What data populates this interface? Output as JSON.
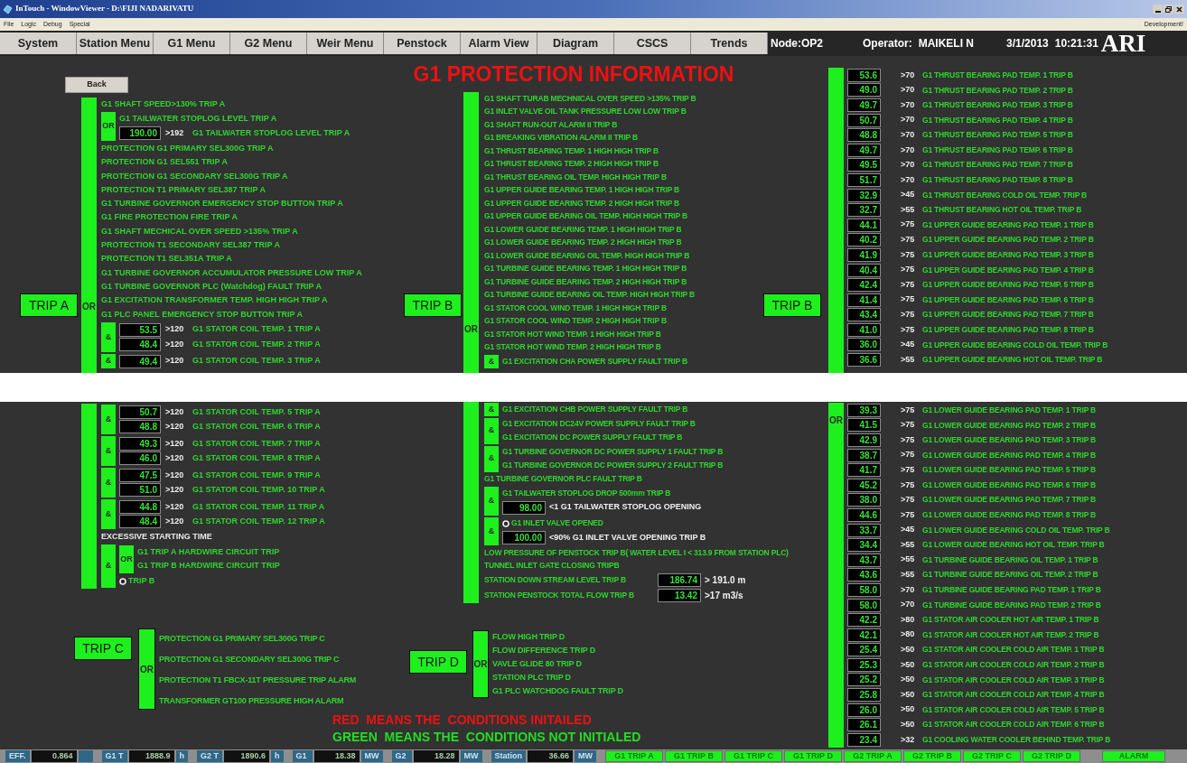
{
  "window": {
    "title": "InTouch - WindowViewer - D:\\FIJI NADARIVATU"
  },
  "menu": [
    "File",
    "Logic",
    "Debug",
    "Special"
  ],
  "mode": "Development!",
  "nav": [
    "System",
    "Station Menu",
    "G1 Menu",
    "G2 Menu",
    "Weir Menu",
    "Penstock",
    "Alarm View",
    "Diagram",
    "CSCS",
    "Trends"
  ],
  "node": "Node:OP2",
  "operator_label": "Operator:",
  "operator": "MAIKELI N",
  "date": "3/1/2013",
  "time": "10:21:31",
  "logo": "ARI",
  "page_title": "G1 PROTECTION INFORMATION",
  "back": "Back",
  "top": {
    "left": {
      "trip": "TRIP A",
      "gate_label": "OR",
      "rows": [
        {
          "kind": "text",
          "text": "G1 SHAFT SPEED>130% TRIP A"
        },
        {
          "kind": "gate",
          "label": "OR",
          "rows": [
            {
              "kind": "text",
              "text": "G1 TAILWATER STOPLOG LEVEL TRIP A"
            },
            {
              "kind": "reading",
              "value": "190.00",
              "limit": ">192",
              "text": "G1 TAILWATER STOPLOG LEVEL TRIP A"
            }
          ]
        },
        {
          "kind": "text",
          "text": "PROTECTION G1 PRIMARY SEL300G TRIP A"
        },
        {
          "kind": "text",
          "text": "PROTECTION G1 SEL551 TRIP A"
        },
        {
          "kind": "text",
          "text": "PROTECTION G1 SECONDARY SEL300G TRIP A"
        },
        {
          "kind": "text",
          "text": "PROTECTION T1 PRIMARY SEL387 TRIP A"
        },
        {
          "kind": "text",
          "text": "G1 TURBINE GOVERNOR EMERGENCY STOP BUTTON TRIP A"
        },
        {
          "kind": "text",
          "text": "G1 FIRE PROTECTION FIRE TRIP A"
        },
        {
          "kind": "text",
          "text": "G1 SHAFT MECHICAL OVER SPEED >135% TRIP A"
        },
        {
          "kind": "text",
          "text": "PROTECTION T1 SECONDARY SEL387 TRIP A"
        },
        {
          "kind": "text",
          "text": "PROTECTION T1 SEL351A TRIP A"
        },
        {
          "kind": "text",
          "text": "G1 TURBINE GOVERNOR ACCUMULATOR PRESSURE LOW TRIP A"
        },
        {
          "kind": "text",
          "text": "G1 TURBINE GOVERNOR PLC (Watchdog) FAULT TRIP A"
        },
        {
          "kind": "text",
          "text": "G1 EXCITATION TRANSFORMER TEMP. HIGH HIGH TRIP A"
        },
        {
          "kind": "text",
          "text": "G1 PLC PANEL EMERGENCY STOP BUTTON TRIP A"
        },
        {
          "kind": "gate",
          "label": "&",
          "rows": [
            {
              "kind": "reading",
              "value": "53.5",
              "limit": ">120",
              "text": "G1 STATOR COIL TEMP. 1 TRIP A"
            },
            {
              "kind": "reading",
              "value": "48.4",
              "limit": ">120",
              "text": "G1 STATOR COIL TEMP. 2 TRIP A"
            }
          ]
        },
        {
          "kind": "gate",
          "label": "&",
          "rows": [
            {
              "kind": "reading",
              "value": "49.4",
              "limit": ">120",
              "text": "G1 STATOR COIL TEMP. 3 TRIP A"
            }
          ]
        }
      ]
    },
    "middle": {
      "trip": "TRIP B",
      "gate_label": "OR",
      "rows": [
        {
          "kind": "text",
          "text": "G1 SHAFT TURAB MECHNICAL OVER SPEED >135% TRIP B"
        },
        {
          "kind": "text",
          "text": "G1 INLET VALVE OIL TANK PRESSURE LOW LOW TRIP B"
        },
        {
          "kind": "text",
          "text": "G1 SHAFT RUN-OUT ALARM II TRIP B"
        },
        {
          "kind": "text",
          "text": "G1 BREAKING VIBRATION ALARM II TRIP B"
        },
        {
          "kind": "text",
          "text": "G1 THRUST BEARING TEMP. 1 HIGH HIGH TRIP B"
        },
        {
          "kind": "text",
          "text": "G1 THRUST BEARING TEMP. 2 HIGH HIGH TRIP B"
        },
        {
          "kind": "text",
          "text": "G1 THRUST BEARING OIL TEMP. HIGH HIGH TRIP B"
        },
        {
          "kind": "text",
          "text": "G1 UPPER GUIDE BEARING TEMP. 1 HIGH HIGH TRIP B"
        },
        {
          "kind": "text",
          "text": "G1 UPPER GUIDE BEARING TEMP. 2 HIGH HIGH TRIP B"
        },
        {
          "kind": "text",
          "text": "G1 UPPER GUIDE BEARING OIL TEMP. HIGH HIGH TRIP B"
        },
        {
          "kind": "text",
          "text": "G1 LOWER GUIDE BEARING TEMP. 1 HIGH HIGH TRIP B"
        },
        {
          "kind": "text",
          "text": "G1 LOWER GUIDE BEARING TEMP. 2 HIGH HIGH TRIP B"
        },
        {
          "kind": "text",
          "text": "G1 LOWER GUIDE BEARING OIL TEMP. HIGH HIGH TRIP B"
        },
        {
          "kind": "text",
          "text": "G1 TURBINE GUIDE BEARING TEMP. 1 HIGH HIGH TRIP B"
        },
        {
          "kind": "text",
          "text": "G1 TURBINE GUIDE BEARING TEMP. 2 HIGH HIGH TRIP B"
        },
        {
          "kind": "text",
          "text": "G1 TURBINE GUIDE BEARING OIL TEMP. HIGH HIGH TRIP B"
        },
        {
          "kind": "text",
          "text": "G1 STATOR COOL WIND TEMP. 1 HIGH HIGH TRIP B"
        },
        {
          "kind": "text",
          "text": "G1 STATOR COOL WIND TEMP. 2 HIGH HIGH TRIP B"
        },
        {
          "kind": "text",
          "text": "G1 STATOR HOT WIND TEMP. 1 HIGH HIGH TRIP B"
        },
        {
          "kind": "text",
          "text": "G1 STATOR HOT WIND TEMP. 2 HIGH HIGH TRIP B"
        },
        {
          "kind": "gate",
          "label": "&",
          "rows": [
            {
              "kind": "text",
              "text": "G1 EXCITATION CHA POWER SUPPLY FAULT TRIP B"
            }
          ]
        }
      ]
    },
    "right": {
      "trip": "TRIP B",
      "rows": [
        {
          "kind": "reading",
          "value": "53.6",
          "limit": ">70",
          "text": "G1 THRUST BEARING PAD TEMP. 1 TRIP B"
        },
        {
          "kind": "reading",
          "value": "49.0",
          "limit": ">70",
          "text": "G1 THRUST BEARING PAD TEMP. 2 TRIP B"
        },
        {
          "kind": "reading",
          "value": "49.7",
          "limit": ">70",
          "text": "G1 THRUST BEARING PAD TEMP. 3 TRIP B"
        },
        {
          "kind": "reading",
          "value": "50.7",
          "limit": ">70",
          "text": "G1 THRUST BEARING PAD TEMP. 4 TRIP B"
        },
        {
          "kind": "reading",
          "value": "48.8",
          "limit": ">70",
          "text": "G1 THRUST BEARING PAD TEMP. 5 TRIP B"
        },
        {
          "kind": "reading",
          "value": "49.7",
          "limit": ">70",
          "text": "G1 THRUST BEARING PAD TEMP. 6 TRIP B"
        },
        {
          "kind": "reading",
          "value": "49.5",
          "limit": ">70",
          "text": "G1 THRUST BEARING PAD TEMP. 7 TRIP B"
        },
        {
          "kind": "reading",
          "value": "51.7",
          "limit": ">70",
          "text": "G1 THRUST BEARING PAD TEMP. 8 TRIP B"
        },
        {
          "kind": "reading",
          "value": "32.9",
          "limit": ">45",
          "text": "G1 THRUST BEARING COLD OIL TEMP. TRIP B"
        },
        {
          "kind": "reading",
          "value": "32.7",
          "limit": ">55",
          "text": "G1 THRUST BEARING HOT OIL TEMP. TRIP B"
        },
        {
          "kind": "reading",
          "value": "44.1",
          "limit": ">75",
          "text": "G1 UPPER GUIDE BEARING PAD TEMP. 1 TRIP B"
        },
        {
          "kind": "reading",
          "value": "40.2",
          "limit": ">75",
          "text": "G1 UPPER GUIDE BEARING PAD TEMP. 2 TRIP B"
        },
        {
          "kind": "reading",
          "value": "41.9",
          "limit": ">75",
          "text": "G1 UPPER GUIDE BEARING PAD TEMP. 3 TRIP B"
        },
        {
          "kind": "reading",
          "value": "40.4",
          "limit": ">75",
          "text": "G1 UPPER GUIDE BEARING PAD TEMP. 4 TRIP B"
        },
        {
          "kind": "reading",
          "value": "42.4",
          "limit": ">75",
          "text": "G1 UPPER GUIDE BEARING PAD TEMP. 5 TRIP B"
        },
        {
          "kind": "reading",
          "value": "41.4",
          "limit": ">75",
          "text": "G1 UPPER GUIDE BEARING PAD TEMP. 6 TRIP B"
        },
        {
          "kind": "reading",
          "value": "43.4",
          "limit": ">75",
          "text": "G1 UPPER GUIDE BEARING PAD TEMP. 7 TRIP B"
        },
        {
          "kind": "reading",
          "value": "41.0",
          "limit": ">75",
          "text": "G1 UPPER GUIDE BEARING PAD TEMP. 8 TRIP B"
        },
        {
          "kind": "reading",
          "value": "36.0",
          "limit": ">45",
          "text": "G1 UPPER GUIDE BEARING COLD OIL TEMP. TRIP B"
        },
        {
          "kind": "reading",
          "value": "36.6",
          "limit": ">55",
          "text": "G1 UPPER GUIDE BEARING HOT OIL TEMP. TRIP B"
        }
      ]
    }
  },
  "bottom": {
    "left": {
      "rows": [
        {
          "kind": "gate",
          "label": "&",
          "rows": [
            {
              "kind": "reading",
              "value": "50.7",
              "limit": ">120",
              "text": "G1 STATOR COIL TEMP. 5 TRIP A"
            },
            {
              "kind": "reading",
              "value": "48.8",
              "limit": ">120",
              "text": "G1 STATOR COIL TEMP. 6 TRIP A"
            }
          ]
        },
        {
          "kind": "gate",
          "label": "&",
          "rows": [
            {
              "kind": "reading",
              "value": "49.3",
              "limit": ">120",
              "text": "G1 STATOR COIL TEMP. 7 TRIP A"
            },
            {
              "kind": "reading",
              "value": "46.0",
              "limit": ">120",
              "text": "G1 STATOR COIL TEMP. 8 TRIP A"
            }
          ]
        },
        {
          "kind": "gate",
          "label": "&",
          "rows": [
            {
              "kind": "reading",
              "value": "47.5",
              "limit": ">120",
              "text": "G1 STATOR COIL TEMP. 9 TRIP A"
            },
            {
              "kind": "reading",
              "value": "51.0",
              "limit": ">120",
              "text": "G1 STATOR COIL TEMP. 10 TRIP A"
            }
          ]
        },
        {
          "kind": "gate",
          "label": "&",
          "rows": [
            {
              "kind": "reading",
              "value": "44.8",
              "limit": ">120",
              "text": "G1 STATOR COIL TEMP. 11 TRIP A"
            },
            {
              "kind": "reading",
              "value": "48.4",
              "limit": ">120",
              "text": "G1 STATOR COIL TEMP. 12 TRIP A"
            }
          ]
        },
        {
          "kind": "note",
          "text": "EXCESSIVE STARTING TIME"
        },
        {
          "kind": "gate",
          "label": "&",
          "rows": [
            {
              "kind": "gate",
              "label": "OR",
              "rows": [
                {
                  "kind": "text",
                  "text": "G1 TRIP A HARDWIRE CIRCUIT TRIP"
                },
                {
                  "kind": "text",
                  "text": "G1 TRIP B HARDWIRE CIRCUIT TRIP"
                }
              ]
            },
            {
              "kind": "indicator",
              "text": "TRIP B"
            }
          ]
        }
      ]
    },
    "trip_c": {
      "trip": "TRIP C",
      "gate": "OR",
      "inputs": [
        "PROTECTION G1 PRIMARY SEL300G TRIP C",
        "PROTECTION G1 SECONDARY SEL300G TRIP C"
      ],
      "alarms": [
        "PROTECTION T1 FBCX-11T PRESSURE TRIP ALARM",
        "TRANSFORMER GT100 PRESSURE HIGH ALARM"
      ]
    },
    "middle": {
      "rows": [
        {
          "kind": "gate",
          "label": "&",
          "rows": [
            {
              "kind": "text",
              "text": "G1 EXCITATION CHB POWER SUPPLY FAULT TRIP B"
            }
          ]
        },
        {
          "kind": "gate",
          "label": "&",
          "rows": [
            {
              "kind": "text",
              "text": "G1 EXCITATION DC24V POWER SUPPLY FAULT TRIP B"
            },
            {
              "kind": "text",
              "text": "G1 EXCITATION DC POWER SUPPLY FAULT TRIP B"
            }
          ]
        },
        {
          "kind": "gate",
          "label": "&",
          "rows": [
            {
              "kind": "text",
              "text": "G1 TURBINE GOVERNOR DC POWER SUPPLY 1 FAULT TRIP B"
            },
            {
              "kind": "text",
              "text": "G1 TURBINE GOVERNOR DC POWER SUPPLY 2 FAULT TRIP B"
            }
          ]
        },
        {
          "kind": "text",
          "text": "G1 TURBINE GOVERNOR PLC FAULT TRIP B"
        },
        {
          "kind": "gate",
          "label": "&",
          "rows": [
            {
              "kind": "text",
              "text": "G1 TAILWATER STOPLOG DROP 500mm TRIP B"
            },
            {
              "kind": "reading",
              "value": "98.00",
              "limit": "<1 G1 TAILWATER STOPLOG OPENING"
            }
          ]
        },
        {
          "kind": "gate",
          "label": "&",
          "rows": [
            {
              "kind": "indicator",
              "text": "G1 INLET VALVE OPENED"
            },
            {
              "kind": "reading",
              "value": "100.00",
              "limit": "<90% G1 INLET VALVE OPENING TRIP B"
            }
          ]
        },
        {
          "kind": "text",
          "text": "LOW PRESSURE OF PENSTOCK TRIP B( WATER LEVEL I < 313.9 FROM STATION PLC)"
        },
        {
          "kind": "text",
          "text": "TUNNEL INLET GATE CLOSING TRIPB"
        },
        {
          "kind": "level",
          "text": "STATION DOWN STREAM LEVEL TRIP B",
          "value": "186.74",
          "limit": "> 191.0 m"
        },
        {
          "kind": "level",
          "text": "STATION PENSTOCK TOTAL FLOW TRIP B",
          "value": "13.42",
          "limit": ">17 m3/s"
        }
      ]
    },
    "trip_d": {
      "trip": "TRIP D",
      "gate": "OR",
      "inputs": [
        "FLOW HIGH TRIP D",
        "FLOW DIFFERENCE TRIP D",
        "VAVLE GLIDE 80 TRIP D",
        "STATION PLC TRIP D",
        "G1 PLC WATCHDOG FAULT TRIP D"
      ]
    },
    "right": {
      "gate_label": "OR",
      "rows": [
        {
          "kind": "reading",
          "value": "39.3",
          "limit": ">75",
          "text": "G1 LOWER GUIDE BEARING PAD TEMP. 1 TRIP B"
        },
        {
          "kind": "reading",
          "value": "41.5",
          "limit": ">75",
          "text": "G1 LOWER GUIDE BEARING PAD TEMP. 2 TRIP B"
        },
        {
          "kind": "reading",
          "value": "42.9",
          "limit": ">75",
          "text": "G1 LOWER GUIDE BEARING PAD TEMP. 3 TRIP B"
        },
        {
          "kind": "reading",
          "value": "38.7",
          "limit": ">75",
          "text": "G1 LOWER GUIDE BEARING PAD TEMP. 4 TRIP B"
        },
        {
          "kind": "reading",
          "value": "41.7",
          "limit": ">75",
          "text": "G1 LOWER GUIDE BEARING PAD TEMP. 5 TRIP B"
        },
        {
          "kind": "reading",
          "value": "45.2",
          "limit": ">75",
          "text": "G1 LOWER GUIDE BEARING PAD TEMP. 6 TRIP B"
        },
        {
          "kind": "reading",
          "value": "38.0",
          "limit": ">75",
          "text": "G1 LOWER GUIDE BEARING PAD TEMP. 7 TRIP B"
        },
        {
          "kind": "reading",
          "value": "44.6",
          "limit": ">75",
          "text": "G1 LOWER GUIDE BEARING PAD TEMP. 8 TRIP B"
        },
        {
          "kind": "reading",
          "value": "33.7",
          "limit": ">45",
          "text": "G1 LOWER GUIDE BEARING COLD OIL TEMP. TRIP B"
        },
        {
          "kind": "reading",
          "value": "34.4",
          "limit": ">55",
          "text": "G1 LOWER GUIDE BEARING HOT OIL TEMP. TRIP B"
        },
        {
          "kind": "reading",
          "value": "43.7",
          "limit": ">55",
          "text": "G1 TURBINE GUIDE BEARING OIL TEMP. 1 TRIP B"
        },
        {
          "kind": "reading",
          "value": "43.6",
          "limit": ">55",
          "text": "G1 TURBINE GUIDE BEARING OIL TEMP. 2 TRIP B"
        },
        {
          "kind": "reading",
          "value": "58.0",
          "limit": ">70",
          "text": "G1 TURBINE GUIDE BEARING PAD TEMP. 1 TRIP B"
        },
        {
          "kind": "reading",
          "value": "58.0",
          "limit": ">70",
          "text": "G1 TURBINE GUIDE BEARING PAD TEMP. 2 TRIP B"
        },
        {
          "kind": "reading",
          "value": "42.2",
          "limit": ">80",
          "text": "G1 STATOR AIR COOLER HOT AIR TEMP. 1 TRIP B"
        },
        {
          "kind": "reading",
          "value": "42.1",
          "limit": ">80",
          "text": "G1 STATOR AIR COOLER HOT AIR TEMP. 2 TRIP B"
        },
        {
          "kind": "reading",
          "value": "25.4",
          "limit": ">50",
          "text": "G1 STATOR AIR COOLER COLD AIR TEMP. 1 TRIP B"
        },
        {
          "kind": "reading",
          "value": "25.3",
          "limit": ">50",
          "text": "G1 STATOR AIR COOLER COLD AIR TEMP. 2 TRIP B"
        },
        {
          "kind": "reading",
          "value": "25.2",
          "limit": ">50",
          "text": "G1 STATOR AIR COOLER COLD AIR TEMP. 3 TRIP B"
        },
        {
          "kind": "reading",
          "value": "25.8",
          "limit": ">50",
          "text": "G1 STATOR AIR COOLER COLD AIR TEMP. 4 TRIP B"
        },
        {
          "kind": "reading",
          "value": "26.0",
          "limit": ">50",
          "text": "G1 STATOR AIR COOLER COLD AIR TEMP. 5 TRIP B"
        },
        {
          "kind": "reading",
          "value": "26.1",
          "limit": ">50",
          "text": "G1 STATOR AIR COOLER COLD AIR TEMP. 6 TRIP B"
        },
        {
          "kind": "reading",
          "value": "23.4",
          "limit": ">32",
          "text": "G1 COOLING WATER COOLER BEHIND TEMP. TRIP B"
        }
      ]
    },
    "legend": [
      {
        "text": "RED  MEANS THE  CONDITIONS INITAILED",
        "color": "#ee1111"
      },
      {
        "text": "GREEN  MEANS THE  CONDITIONS NOT INITIALED",
        "color": "#22dd22"
      }
    ]
  },
  "status_bar": {
    "readings": [
      {
        "label": "EFF.",
        "value": "0.864"
      },
      {
        "label": "G1 T",
        "value": "1888.9",
        "unit": "h"
      },
      {
        "label": "G2 T",
        "value": "1890.6",
        "unit": "h"
      },
      {
        "label": "G1",
        "value": "18.38",
        "unit": "MW"
      },
      {
        "label": "G2",
        "value": "18.28",
        "unit": "MW"
      },
      {
        "label": "Station",
        "value": "36.66",
        "unit": "MW"
      }
    ],
    "trips": [
      {
        "label": "G1 TRIP A",
        "initiated": false
      },
      {
        "label": "G1 TRIP B",
        "initiated": false
      },
      {
        "label": "G1 TRIP C",
        "initiated": false
      },
      {
        "label": "G1 TRIP D",
        "initiated": false
      },
      {
        "label": "G2 TRIP A",
        "initiated": false
      },
      {
        "label": "G2 TRIP B",
        "initiated": false
      },
      {
        "label": "G2 TRIP C",
        "initiated": false
      },
      {
        "label": "G2 TRIP D",
        "initiated": false
      }
    ],
    "alarm": {
      "label": "ALARM",
      "initiated": false
    }
  }
}
